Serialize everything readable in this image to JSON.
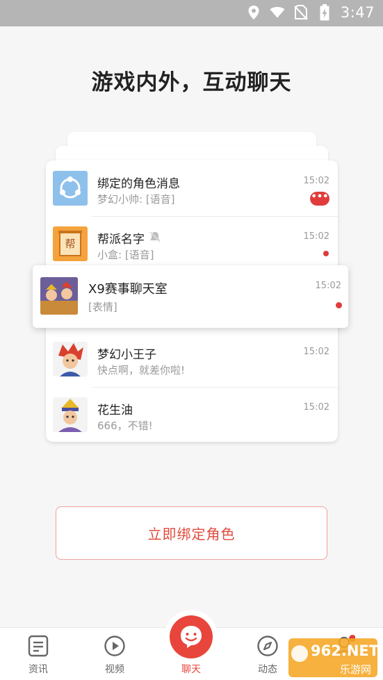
{
  "status_bar": {
    "time": "3:47",
    "icons": [
      "location-icon",
      "wifi-icon",
      "no-sim-icon",
      "battery-charging-icon"
    ]
  },
  "headline": "游戏内外，互动聊天",
  "chats": [
    {
      "title": "绑定的角色消息",
      "subtitle": "梦幻小帅: [语音]",
      "time": "15:02",
      "badge": "•••",
      "avatar": "share-icon",
      "avatar_color": "#8ec0ec"
    },
    {
      "title": "帮派名字",
      "subtitle": "小盒: [语音]",
      "time": "15:02",
      "muted": true,
      "avatar_glyph": "帮",
      "avatar_color": "#f5a33c"
    },
    {
      "title": "X9赛事聊天室",
      "subtitle": "[表情]",
      "time": "15:02"
    },
    {
      "title": "梦幻小王子",
      "subtitle": "快点啊，就差你啦!",
      "time": "15:02"
    },
    {
      "title": "花生油",
      "subtitle": "666，不错!",
      "time": "15:02"
    }
  ],
  "bind_button": "立即绑定角色",
  "tabs": [
    {
      "label": "资讯",
      "icon": "news-icon"
    },
    {
      "label": "视频",
      "icon": "play-icon"
    },
    {
      "label": "聊天",
      "icon": "chat-smile-icon",
      "active": true
    },
    {
      "label": "动态",
      "icon": "compass-icon"
    },
    {
      "label": "",
      "icon": "profile-icon"
    }
  ],
  "watermark": {
    "brand": "962.NET",
    "sub": "乐游网"
  },
  "colors": {
    "accent": "#e8453c",
    "status_bar": "#b5b5b5",
    "background": "#f6f6f6"
  }
}
